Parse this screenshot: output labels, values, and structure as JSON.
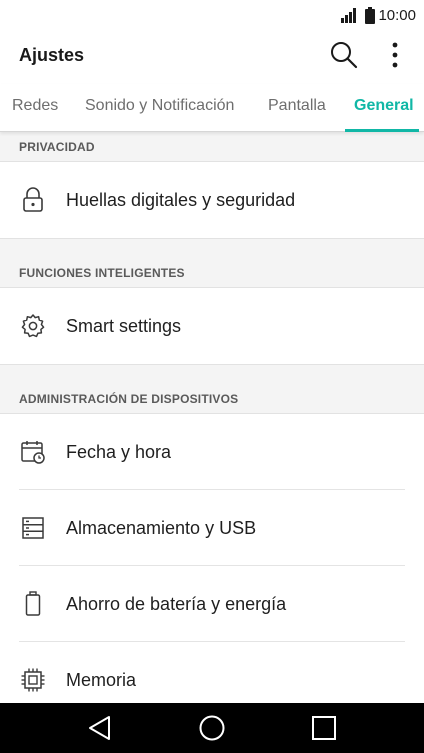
{
  "status_bar": {
    "time": "10:00"
  },
  "app_bar": {
    "title": "Ajustes",
    "search_icon": "search-icon",
    "menu_icon": "more-vert-icon"
  },
  "tabs": [
    {
      "label": "Redes",
      "active": false
    },
    {
      "label": "Sonido y Notificación",
      "active": false
    },
    {
      "label": "Pantalla",
      "active": false
    },
    {
      "label": "General",
      "active": true
    }
  ],
  "sections": [
    {
      "header": "PRIVACIDAD",
      "items": [
        {
          "label": "Huellas digitales y seguridad",
          "icon": "lock-icon"
        }
      ]
    },
    {
      "header": "FUNCIONES INTELIGENTES",
      "items": [
        {
          "label": "Smart settings",
          "icon": "smart-settings-gear-icon"
        }
      ]
    },
    {
      "header": "ADMINISTRACIÓN DE DISPOSITIVOS",
      "items": [
        {
          "label": "Fecha y hora",
          "icon": "calendar-clock-icon"
        },
        {
          "label": "Almacenamiento y USB",
          "icon": "storage-icon"
        },
        {
          "label": "Ahorro de batería y energía",
          "icon": "battery-icon"
        },
        {
          "label": "Memoria",
          "icon": "memory-chip-icon"
        }
      ]
    }
  ],
  "nav_bar": {
    "back_icon": "back-icon",
    "home_icon": "home-icon",
    "recents_icon": "recents-icon"
  },
  "colors": {
    "accent": "#11b7a6",
    "section_bg": "#f4f4f4",
    "nav_bg": "#000000"
  }
}
